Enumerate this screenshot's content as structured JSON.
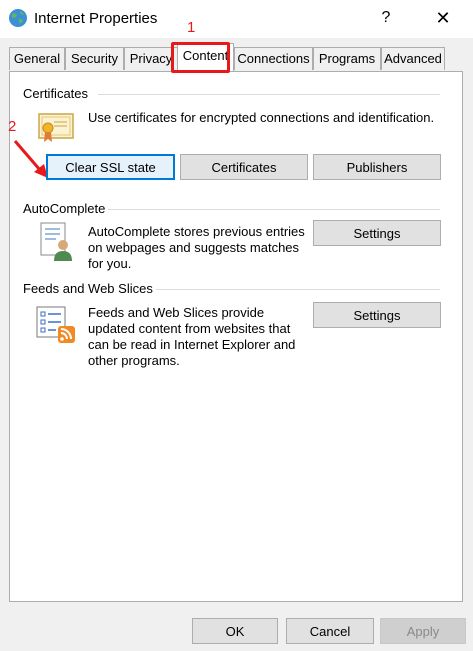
{
  "window": {
    "title": "Internet Properties",
    "help_glyph": "?",
    "close_glyph": "✕"
  },
  "tabs": [
    {
      "label": "General"
    },
    {
      "label": "Security"
    },
    {
      "label": "Privacy"
    },
    {
      "label": "Content",
      "active": true
    },
    {
      "label": "Connections"
    },
    {
      "label": "Programs"
    },
    {
      "label": "Advanced"
    }
  ],
  "annotations": {
    "step1": "1",
    "step2": "2",
    "color": "#e8191b"
  },
  "certificates": {
    "title": "Certificates",
    "description": "Use certificates for encrypted connections and identification.",
    "icon": "certificate-icon",
    "buttons": {
      "clear_ssl": "Clear SSL state",
      "certificates": "Certificates",
      "publishers": "Publishers"
    }
  },
  "autocomplete": {
    "title": "AutoComplete",
    "description_lines": [
      "AutoComplete stores previous entries",
      "on webpages and suggests matches",
      "for you."
    ],
    "icon": "autocomplete-user-icon",
    "settings_label": "Settings"
  },
  "feeds": {
    "title": "Feeds and Web Slices",
    "description_lines": [
      "Feeds and Web Slices provide",
      "updated content from websites that",
      "can be read in Internet Explorer and",
      "other programs."
    ],
    "icon": "rss-feed-icon",
    "settings_label": "Settings"
  },
  "footer": {
    "ok": "OK",
    "cancel": "Cancel",
    "apply": "Apply"
  },
  "colors": {
    "accent": "#0078d7",
    "highlight": "#e8191b"
  }
}
